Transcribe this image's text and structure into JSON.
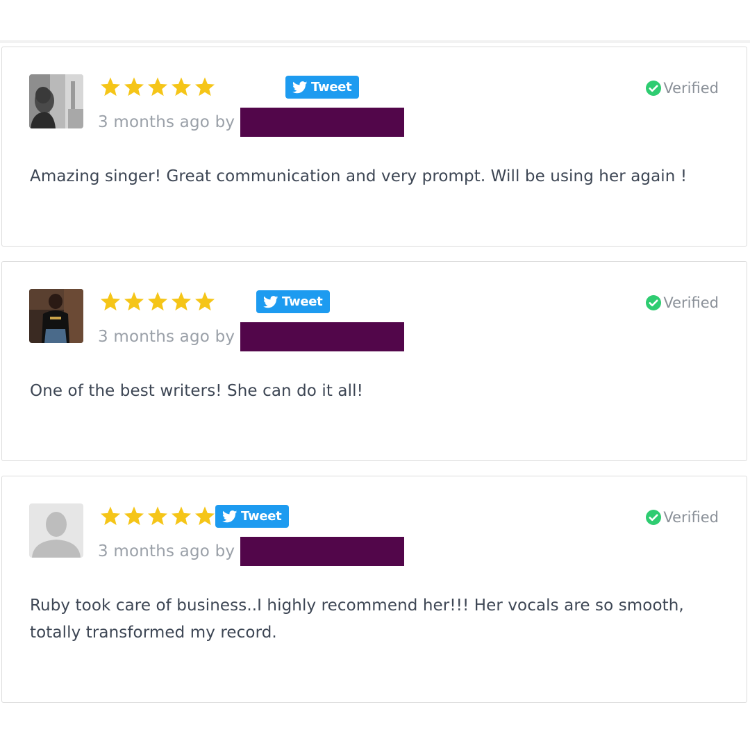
{
  "colors": {
    "star": "#f5c518",
    "tweet": "#1d9bf0",
    "verified": "#2ecc71",
    "redaction": "#52064a"
  },
  "reviews": [
    {
      "avatar": "bald-man-photo",
      "rating": 5,
      "tweet_label": "Tweet",
      "time": "3 months ago by",
      "verified_label": "Verified",
      "text": "Amazing singer! Great communication and very prompt. Will be using her again !"
    },
    {
      "avatar": "man-black-shirt-photo",
      "rating": 5,
      "tweet_label": "Tweet",
      "time": "3 months ago by",
      "verified_label": "Verified",
      "text": "One of the best writers! She can do it all!"
    },
    {
      "avatar": "default-user-silhouette",
      "rating": 5,
      "tweet_label": "Tweet",
      "time": "3 months ago by",
      "verified_label": "Verified",
      "text": "Ruby took care of business..I highly recommend her!!! Her vocals are so smooth, totally transformed my record."
    }
  ]
}
